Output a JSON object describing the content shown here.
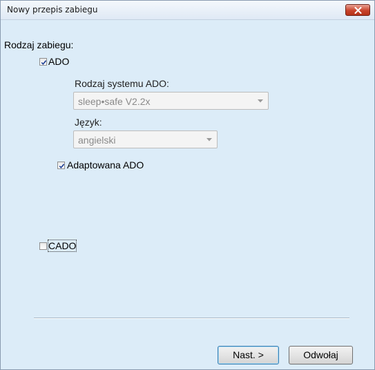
{
  "window": {
    "title": "Nowy przepis zabiegu"
  },
  "form": {
    "treatment_type_label": "Rodzaj zabiegu:",
    "ado": {
      "label": "ADO",
      "checked": true,
      "system_type_label": "Rodzaj systemu ADO:",
      "system_type_value": "sleep•safe V2.2x",
      "language_label": "Język:",
      "language_value": "angielski",
      "adapted": {
        "label": "Adaptowana ADO",
        "checked": true
      }
    },
    "cado": {
      "label": "CADO",
      "checked": false
    }
  },
  "buttons": {
    "next_label": "Nast. >",
    "cancel_label": "Odwołaj"
  },
  "icons": {
    "close": "close-icon",
    "check": "checkmark-icon",
    "dropdown": "chevron-down-icon"
  },
  "colors": {
    "client_background": "#dcecf8",
    "close_button": "#c9442c",
    "disabled_text": "#8a8a8a"
  }
}
